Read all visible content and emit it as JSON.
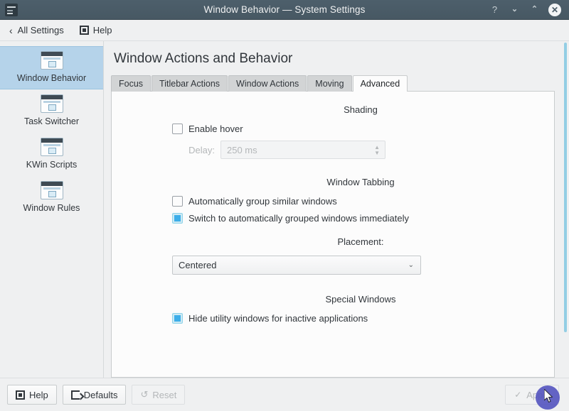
{
  "titlebar": {
    "title": "Window Behavior — System Settings",
    "app_icon": "system-settings-icon",
    "buttons": [
      {
        "name": "help-button",
        "glyph": "?"
      },
      {
        "name": "minimize-button",
        "glyph": "⌄"
      },
      {
        "name": "maximize-button",
        "glyph": "⌃"
      },
      {
        "name": "close-button",
        "glyph": "✕"
      }
    ]
  },
  "toolbar": {
    "back_chevron": "‹",
    "all_settings_label": "All Settings",
    "help_label": "Help"
  },
  "sidebar": {
    "items": [
      {
        "label": "Window Behavior",
        "selected": true
      },
      {
        "label": "Task Switcher",
        "selected": false
      },
      {
        "label": "KWin Scripts",
        "selected": false
      },
      {
        "label": "Window Rules",
        "selected": false
      }
    ]
  },
  "main": {
    "page_title": "Window Actions and Behavior",
    "tabs": [
      {
        "label": "Focus",
        "active": false
      },
      {
        "label": "Titlebar Actions",
        "active": false
      },
      {
        "label": "Window Actions",
        "active": false
      },
      {
        "label": "Moving",
        "active": false
      },
      {
        "label": "Advanced",
        "active": true
      }
    ],
    "sections": {
      "shading": {
        "heading": "Shading",
        "enable_hover_label": "Enable hover",
        "enable_hover_checked": false,
        "delay_label": "Delay:",
        "delay_value": "250 ms",
        "delay_enabled": false
      },
      "window_tabbing": {
        "heading": "Window Tabbing",
        "auto_group_label": "Automatically group similar windows",
        "auto_group_checked": false,
        "switch_group_label": "Switch to automatically grouped windows immediately",
        "switch_group_checked": true
      },
      "placement": {
        "heading": "Placement:",
        "selected_value": "Centered",
        "chevron": "⌄"
      },
      "special_windows": {
        "heading": "Special Windows",
        "hide_utility_label": "Hide utility windows for inactive applications",
        "hide_utility_checked": true
      }
    }
  },
  "bottombar": {
    "help_label": "Help",
    "defaults_label": "Defaults",
    "reset_label": "Reset",
    "reset_enabled": false,
    "reset_glyph": "↺",
    "apply_label": "Apply",
    "apply_enabled": false,
    "apply_glyph": "✓"
  },
  "colors": {
    "titlebar": "#4d5f6b",
    "accent": "#3daee9",
    "selection": "#b5d3ea",
    "scrollbar": "#93cee4",
    "cursor_halo": "#4e4fbd"
  }
}
